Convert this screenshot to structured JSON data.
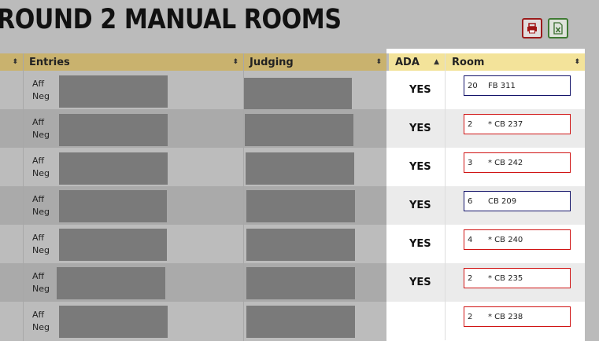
{
  "page": {
    "title": "ROUND 2 MANUAL ROOMS"
  },
  "toolbar": {
    "print_icon": "printer-icon",
    "excel_icon": "excel-file-icon"
  },
  "table": {
    "columns": [
      {
        "label": "",
        "sort": "⬍"
      },
      {
        "label": "Entries",
        "sort": "⬍"
      },
      {
        "label": "Judging",
        "sort": "⬍"
      },
      {
        "label": "ADA",
        "sort": "▲"
      },
      {
        "label": "Room",
        "sort": "⬍"
      }
    ],
    "side_labels": {
      "aff": "Aff",
      "neg": "Neg"
    },
    "rows": [
      {
        "ada": "YES",
        "room_num": "20",
        "room_name": "FB 311",
        "room_style": "blue"
      },
      {
        "ada": "YES",
        "room_num": "2",
        "room_name": "* CB 237",
        "room_style": "red"
      },
      {
        "ada": "YES",
        "room_num": "3",
        "room_name": "* CB 242",
        "room_style": "red"
      },
      {
        "ada": "YES",
        "room_num": "6",
        "room_name": "CB 209",
        "room_style": "blue"
      },
      {
        "ada": "YES",
        "room_num": "4",
        "room_name": "* CB 240",
        "room_style": "red"
      },
      {
        "ada": "YES",
        "room_num": "2",
        "room_name": "* CB 235",
        "room_style": "red"
      },
      {
        "ada": "",
        "room_num": "2",
        "room_name": "* CB 238",
        "room_style": "red"
      }
    ]
  },
  "colors": {
    "header": "#c9b26e",
    "ada_header": "#f3e39a",
    "accent_red": "#d01414",
    "accent_blue": "#14146a"
  }
}
